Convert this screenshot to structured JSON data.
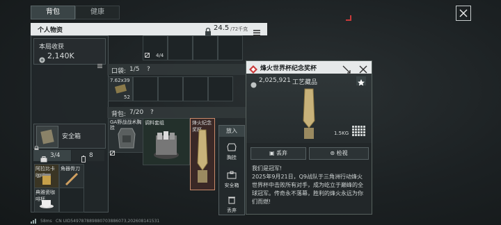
{
  "tabs": [
    {
      "label": "背包",
      "active": true
    },
    {
      "label": "健康",
      "active": false
    }
  ],
  "personal": {
    "title": "个人物资",
    "weight": "24.5",
    "weight_max": "/72千克"
  },
  "income": {
    "label": "本局收获",
    "value": "2,140K"
  },
  "top_slot_count": "4/4",
  "pocket": {
    "label": "口袋:",
    "count": "1/5",
    "help": "?",
    "ammo_label": "7.62x39",
    "ammo_count": "52"
  },
  "backpack": {
    "label": "背包:",
    "count": "7/20",
    "help": "?",
    "item1_label": "GA野战战术胸挂",
    "item2_label": "调料套组",
    "item3_label": "烽火纪念奖杯"
  },
  "safe_box": {
    "label": "安全箱"
  },
  "counters": {
    "left": "3/4",
    "right": "8"
  },
  "safe_items": {
    "item1": "阿拉比卡咖啡",
    "item2": "角器骨刀",
    "item3": "典雅瓷咖啡杯"
  },
  "context_menu": {
    "header": "放入",
    "equip": "胸挂",
    "safe": "安全箱",
    "discard": "丢弃"
  },
  "detail": {
    "title": "烽火世界杯纪念奖杯",
    "price": "2,025,921",
    "category": "工艺藏品",
    "weight": "1.5KG",
    "discard_label": "丢弃",
    "inspect_label": "检视",
    "desc_title": "我们是冠军!",
    "desc_body": "2025年9月21日，Q9战队于三角洲行动烽火世界杯中击败所有对手，成为屹立于巅峰的全球冠军。传奇永不落幕，胜利的烽火永远为你们而燃!"
  },
  "status": {
    "ping": "58ms",
    "uid": "CN UID549787889880703886073,202608141531"
  },
  "colors": {
    "accent_red": "#c93a3a",
    "panel_bg": "#282e30",
    "header_light": "#e6e9ea"
  }
}
